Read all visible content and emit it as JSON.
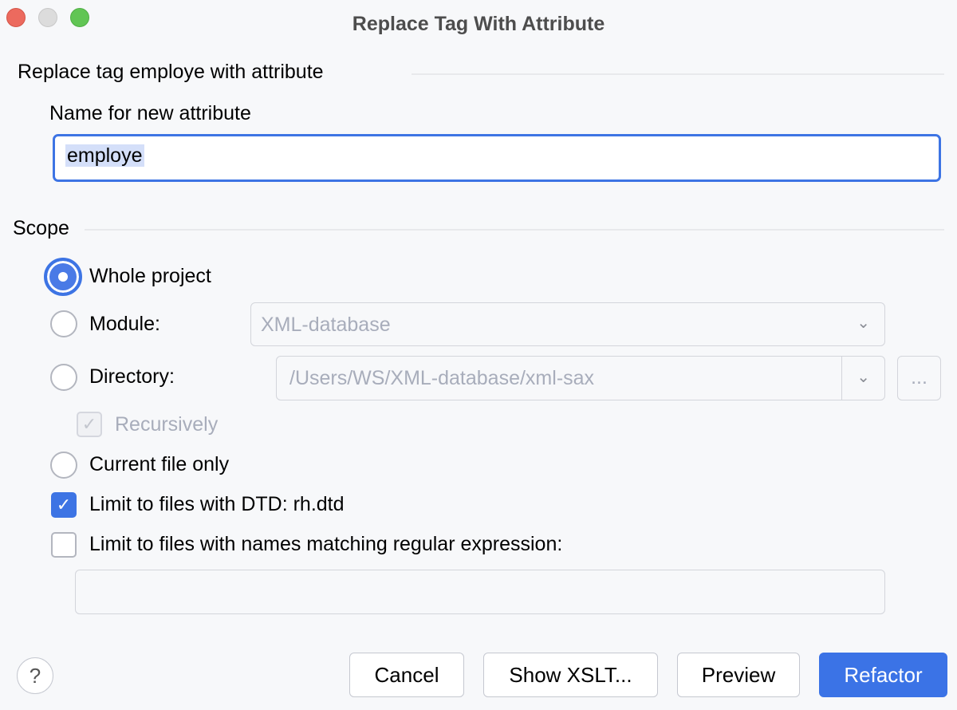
{
  "window": {
    "title": "Replace Tag With Attribute"
  },
  "header": {
    "text": "Replace tag employe with attribute"
  },
  "name_field": {
    "label": "Name for new attribute",
    "value": "employe"
  },
  "scope": {
    "label": "Scope",
    "whole_project": "Whole project",
    "module": "Module:",
    "module_value": "XML-database",
    "directory": "Directory:",
    "directory_value": "/Users/WS/XML-database/xml-sax",
    "browse": "...",
    "recursively": "Recursively",
    "current_file": "Current file only",
    "limit_dtd": "Limit to files with DTD: rh.dtd",
    "limit_regex": "Limit to files with names matching regular expression:",
    "regex_value": ""
  },
  "buttons": {
    "help": "?",
    "cancel": "Cancel",
    "show_xslt": "Show XSLT...",
    "preview": "Preview",
    "refactor": "Refactor"
  }
}
